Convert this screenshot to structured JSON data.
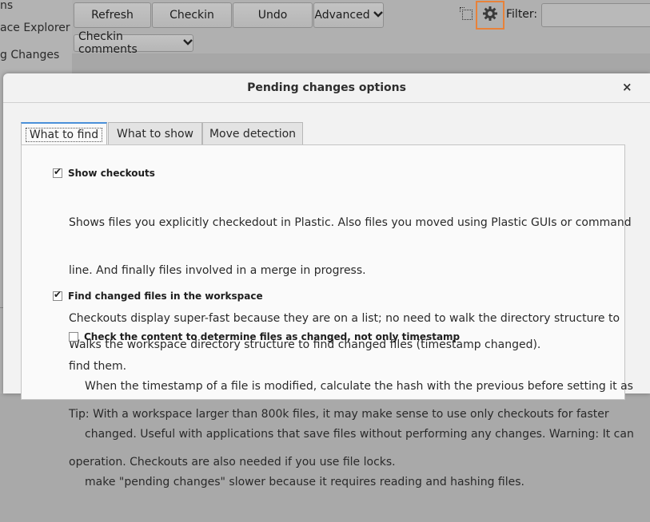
{
  "background": {
    "sidebar_items": [
      "ns",
      "ace Explorer",
      "g Changes"
    ],
    "toolbar": {
      "refresh": "Refresh",
      "checkin": "Checkin",
      "undo": "Undo",
      "advanced": "Advanced",
      "filter_label": "Filter:",
      "filter_value": "",
      "checkin_comments": "Checkin comments"
    }
  },
  "dialog": {
    "title": "Pending changes options",
    "close": "×",
    "tabs": [
      "What to find",
      "What to show",
      "Move detection"
    ],
    "active_tab": "What to find",
    "options": [
      {
        "label": "Show checkouts",
        "checked": true,
        "description": [
          "Shows files you explicitly checkedout in Plastic. Also files you moved using Plastic GUIs or command",
          "line. And finally files involved in a merge in progress.",
          "Checkouts display super-fast because they are on a list; no need to walk the directory structure to",
          "find them.",
          "Tip: With a workspace larger than 800k files, it may make sense to use only checkouts for faster",
          "operation. Checkouts are also needed if you use file locks."
        ]
      },
      {
        "label": "Find changed files in the workspace",
        "checked": true,
        "description": [
          "Walks the workspace directory structure to find changed files (timestamp changed)."
        ]
      },
      {
        "label": "Check the content to determine files as changed, not only timestamp",
        "checked": false,
        "description": [
          "When the timestamp of a file is modified, calculate the hash with the previous before setting it as",
          "changed. Useful with applications that save files without performing any changes. Warning: It can",
          "make \"pending changes\" slower because it requires reading and hashing files."
        ]
      }
    ]
  },
  "colors": {
    "highlight": "#e8823a",
    "tab_focus": "#4a90d9"
  }
}
